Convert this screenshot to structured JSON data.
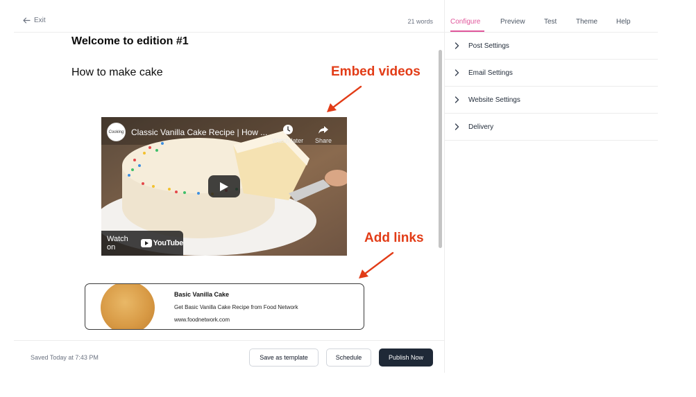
{
  "editor": {
    "exit_label": "Exit",
    "word_count": "21 words",
    "title": "Welcome to edition #1",
    "heading": "How to make cake",
    "annotations": {
      "embed_videos": "Embed videos",
      "add_links": "Add links",
      "color": "#e23c17"
    },
    "video": {
      "channel_logo_text": "Cooking",
      "title": "Classic Vanilla Cake Recipe | How ...",
      "watch_later_label": "Watch later",
      "share_label": "Share",
      "watch_on_label": "Watch on",
      "youtube_label": "YouTube",
      "icons": [
        "clock-icon",
        "share-icon",
        "play-icon",
        "youtube-logo-icon"
      ]
    },
    "link_card": {
      "title": "Basic Vanilla Cake",
      "description": "Get Basic Vanilla Cake Recipe from Food Network",
      "url": "www.foodnetwork.com"
    }
  },
  "footer": {
    "saved_status": "Saved Today at 7:43 PM",
    "save_template_label": "Save as template",
    "schedule_label": "Schedule",
    "publish_label": "Publish Now",
    "publish_color": "#1f2937"
  },
  "settings_panel": {
    "tabs": [
      {
        "label": "Configure",
        "active": true
      },
      {
        "label": "Preview",
        "active": false
      },
      {
        "label": "Test",
        "active": false
      },
      {
        "label": "Theme",
        "active": false
      },
      {
        "label": "Help",
        "active": false
      }
    ],
    "active_tab_color": "#e0569b",
    "sections": [
      {
        "label": "Post Settings"
      },
      {
        "label": "Email Settings"
      },
      {
        "label": "Website Settings"
      },
      {
        "label": "Delivery"
      }
    ]
  }
}
